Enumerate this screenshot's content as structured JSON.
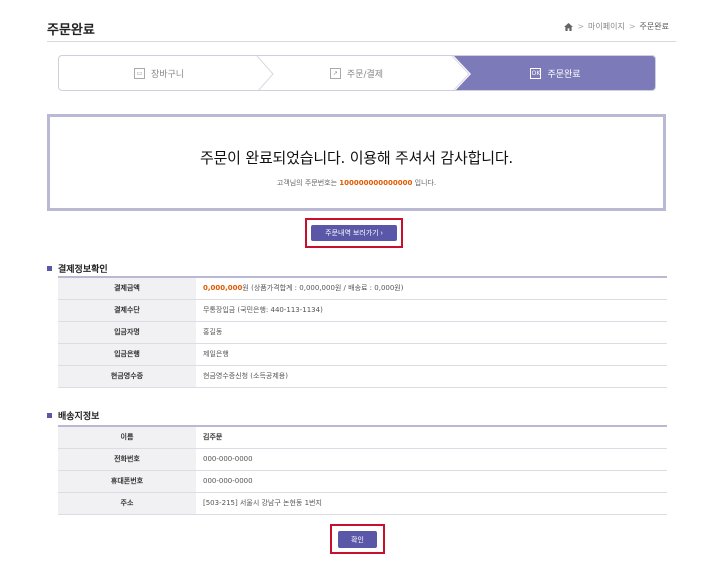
{
  "header": {
    "title": "주문완료",
    "breadcrumb": [
      "마이페이지",
      "주문완료"
    ]
  },
  "steps": [
    {
      "label": "장바구니",
      "icon": "cart-icon",
      "active": false
    },
    {
      "label": "주문/결제",
      "icon": "order-icon",
      "active": false
    },
    {
      "label": "주문완료",
      "icon": "ok-icon",
      "icon_text": "OK",
      "active": true
    }
  ],
  "completion": {
    "message": "주문이 완료되었습니다. 이용해 주셔서 감사합니다.",
    "sub_prefix": "고객님의 주문번호는",
    "order_number": "100000000000000",
    "sub_suffix": "입니다."
  },
  "buttons": {
    "view_order": "주문내역 보러가기 ›",
    "confirm": "확인"
  },
  "payment": {
    "title": "결제정보확인",
    "rows": [
      {
        "label": "결제금액",
        "price": "0,000,000",
        "value": "원 (상품가격합계 : 0,000,000원 / 배송료 : 0,000원)"
      },
      {
        "label": "결제수단",
        "value": "무통장입금 (국민은행: 440-113-1134)"
      },
      {
        "label": "입금자명",
        "value": "홍길동"
      },
      {
        "label": "입금은행",
        "value": "제일은행"
      },
      {
        "label": "현금영수증",
        "value": "현금영수증신청 (소득공제용)"
      }
    ]
  },
  "shipping": {
    "title": "배송지정보",
    "rows": [
      {
        "label": "이름",
        "value": "김주문"
      },
      {
        "label": "전화번호",
        "value": "000-000-0000"
      },
      {
        "label": "휴대폰번호",
        "value": "000-000-0000"
      },
      {
        "label": "주소",
        "value": "[503-215] 서울시 강남구 논현동 1번지"
      }
    ]
  },
  "colors": {
    "accent": "#5a56a8",
    "highlight": "#c8102e",
    "price": "#e05a00"
  }
}
